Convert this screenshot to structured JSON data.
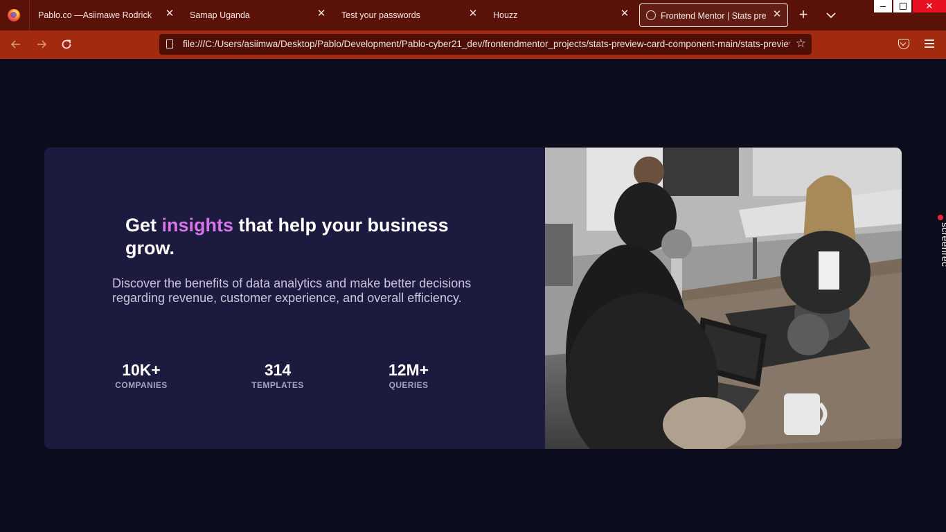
{
  "browser": {
    "tabs": [
      {
        "label": "Pablo.co —Asiimawe Rodrick"
      },
      {
        "label": "Samap Uganda"
      },
      {
        "label": "Test your passwords"
      },
      {
        "label": "Houzz"
      },
      {
        "label": "Frontend Mentor | Stats preview card component"
      }
    ],
    "url": "file:///C:/Users/asiimwa/Desktop/Pablo/Development/Pablo-cyber21_dev/frontendmentor_projects/stats-preview-card-component-main/stats-preview-card-component-main/index.html",
    "icons": {
      "back": "arrow-left-icon",
      "forward": "arrow-right-icon",
      "reload": "reload-icon",
      "star": "star-icon",
      "pocket": "pocket-icon",
      "menu": "hamburger-menu-icon",
      "close_tab": "close-icon",
      "new_tab": "plus-icon",
      "list_tabs": "chevron-down-icon"
    }
  },
  "card": {
    "headline_start": "Get ",
    "headline_accent": "insights",
    "headline_end": " that help your business grow.",
    "description": "Discover the benefits of data analytics and make better decisions regarding revenue, customer experience, and overall efficiency.",
    "stats": [
      {
        "value": "10K+",
        "label": "COMPANIES"
      },
      {
        "value": "314",
        "label": "TEMPLATES"
      },
      {
        "value": "12M+",
        "label": "QUERIES"
      }
    ],
    "image_alt": "people working at a shared office desk",
    "colors": {
      "accent": "#d575e8",
      "card_bg": "#1c1a3e",
      "page_bg": "#0b0c1c"
    }
  },
  "overlay": {
    "recorder_label": "screenrec"
  }
}
